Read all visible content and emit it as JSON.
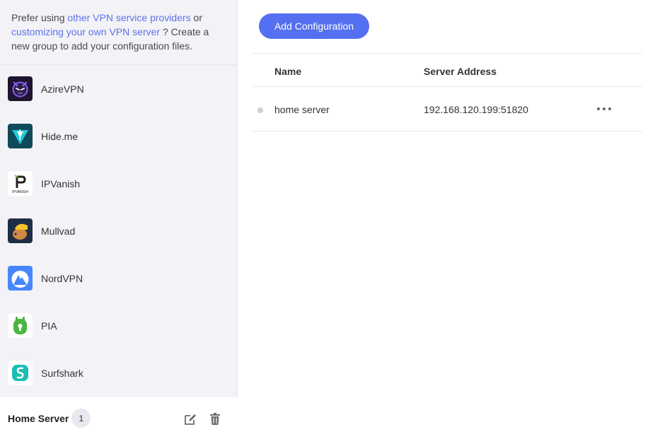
{
  "sidebar": {
    "intro": {
      "prefix": "Prefer using ",
      "link_providers": "other VPN service providers",
      "middle": " or ",
      "link_custom": "customizing your own VPN server",
      "suffix": " ? Create a new group to add your configuration files."
    },
    "providers": [
      {
        "name": "AzireVPN",
        "icon": "azirevpn-logo-icon"
      },
      {
        "name": "Hide.me",
        "icon": "hideme-logo-icon"
      },
      {
        "name": "IPVanish",
        "icon": "ipvanish-logo-icon"
      },
      {
        "name": "Mullvad",
        "icon": "mullvad-logo-icon"
      },
      {
        "name": "NordVPN",
        "icon": "nordvpn-logo-icon"
      },
      {
        "name": "PIA",
        "icon": "pia-logo-icon"
      },
      {
        "name": "Surfshark",
        "icon": "surfshark-logo-icon"
      }
    ],
    "group": {
      "name": "Home Server",
      "count": "1",
      "edit_icon": "edit-icon",
      "delete_icon": "trash-icon"
    }
  },
  "main": {
    "add_button": "Add Configuration",
    "table": {
      "columns": {
        "name": "Name",
        "address": "Server Address"
      },
      "rows": [
        {
          "name": "home server",
          "address": "192.168.120.199:51820",
          "status_color": "#cfcfd4"
        }
      ]
    }
  },
  "colors": {
    "accent": "#5470f0",
    "link": "#5a73e8",
    "sidebar_bg": "#f3f2f7"
  }
}
